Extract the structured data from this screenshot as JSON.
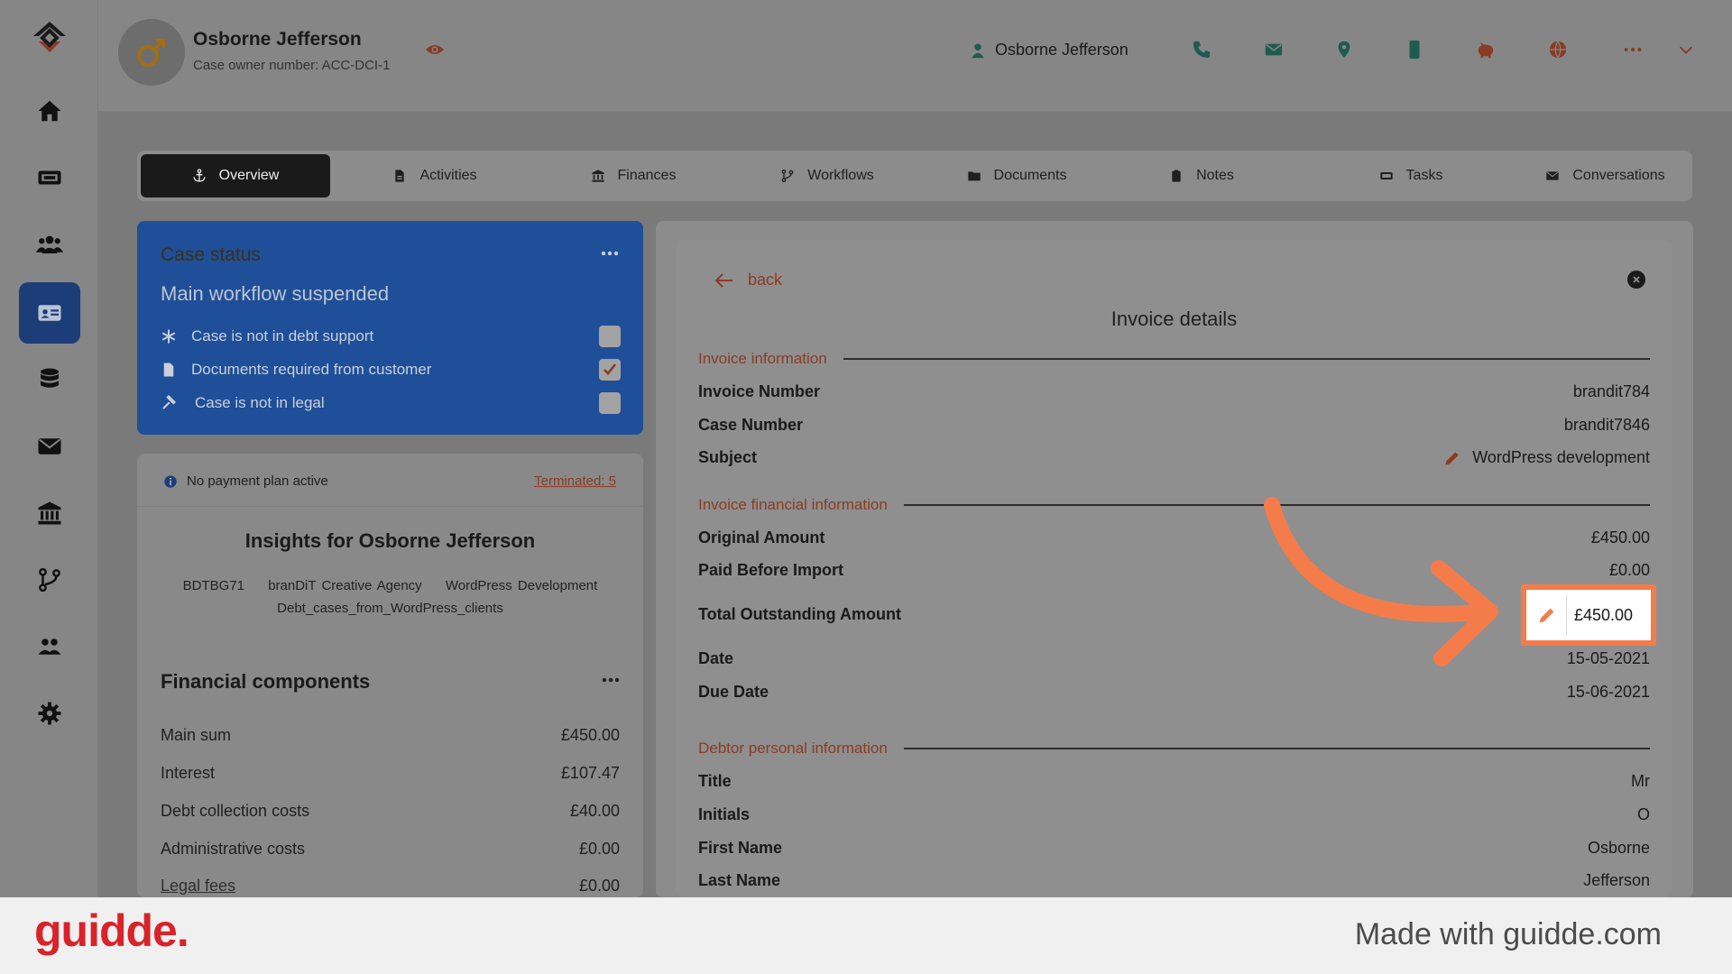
{
  "header": {
    "case_name": "Osborne Jefferson",
    "case_owner": "Case owner number: ACC-DCI-1",
    "user_name": "Osborne Jefferson",
    "icons": [
      "phone-icon",
      "mail-icon",
      "location-icon",
      "mobile-icon",
      "piggy-bank-icon",
      "globe-icon",
      "more-icon",
      "chevron-down-icon"
    ]
  },
  "sidebar": {
    "items": [
      "home",
      "tickets",
      "teams",
      "cases",
      "database",
      "mail",
      "bank",
      "workflows",
      "users",
      "settings"
    ],
    "active": "cases"
  },
  "tabs": [
    {
      "label": "Overview",
      "icon": "anchor-icon",
      "active": true
    },
    {
      "label": "Activities",
      "icon": "file-icon"
    },
    {
      "label": "Finances",
      "icon": "bank-icon"
    },
    {
      "label": "Workflows",
      "icon": "branch-icon"
    },
    {
      "label": "Documents",
      "icon": "folder-icon"
    },
    {
      "label": "Notes",
      "icon": "clipboard-icon"
    },
    {
      "label": "Tasks",
      "icon": "ticket-icon"
    },
    {
      "label": "Conversations",
      "icon": "mail-icon"
    }
  ],
  "case_status": {
    "title": "Case status",
    "subtitle": "Main workflow suspended",
    "items": [
      {
        "label": "Case is not in debt support",
        "checked": false
      },
      {
        "label": "Documents required from customer",
        "checked": true
      },
      {
        "label": "Case is not in legal",
        "checked": false
      }
    ]
  },
  "insights": {
    "payment_plan": "No payment plan active",
    "terminated": "Terminated: 5",
    "title": "Insights for Osborne Jefferson",
    "tags": [
      "BDTBG71",
      "branDiT Creative Agency",
      "WordPress Development"
    ],
    "tag_extra": "Debt_cases_from_WordPress_clients",
    "financial_title": "Financial components",
    "components": [
      {
        "label": "Main sum",
        "value": "£450.00"
      },
      {
        "label": "Interest",
        "value": "£107.47"
      },
      {
        "label": "Debt collection costs",
        "value": "£40.00"
      },
      {
        "label": "Administrative costs",
        "value": "£0.00"
      },
      {
        "label": "Legal fees",
        "value": "£0.00"
      }
    ]
  },
  "invoice": {
    "back_label": "back",
    "title": "Invoice details",
    "section_info": "Invoice information",
    "invoice_number_label": "Invoice Number",
    "invoice_number": "brandit784",
    "case_number_label": "Case Number",
    "case_number": "brandit7846",
    "subject_label": "Subject",
    "subject": "WordPress development",
    "section_financial": "Invoice financial information",
    "original_amount_label": "Original Amount",
    "original_amount": "£450.00",
    "paid_before_label": "Paid Before Import",
    "paid_before": "£0.00",
    "outstanding_label": "Total Outstanding Amount",
    "outstanding": "£450.00",
    "date_label": "Date",
    "date": "15-05-2021",
    "due_date_label": "Due Date",
    "due_date": "15-06-2021",
    "section_debtor": "Debtor personal information",
    "title_label": "Title",
    "title_value": "Mr",
    "initials_label": "Initials",
    "initials": "O",
    "first_name_label": "First Name",
    "first_name": "Osborne",
    "last_name_label": "Last Name",
    "last_name": "Jefferson"
  },
  "footer": {
    "brand": "guidde.",
    "made_with": "Made with guidde.com"
  },
  "colors": {
    "accent": "#8a3b23",
    "highlight": "#f47c4a",
    "status_card": "#1f4f98",
    "brand": "#d9232a"
  }
}
